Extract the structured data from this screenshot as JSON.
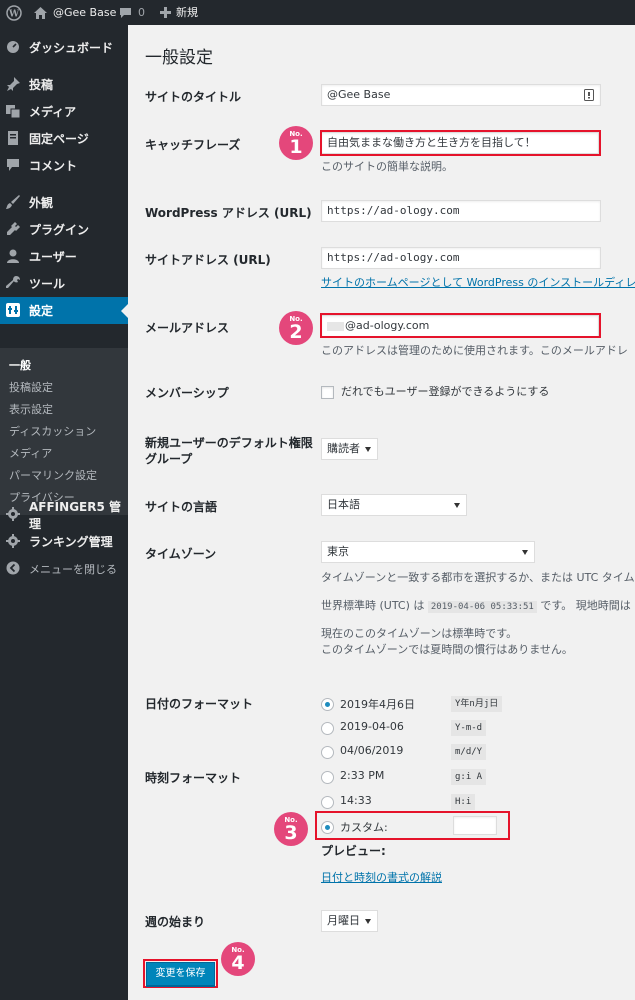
{
  "admin_bar": {
    "site_name": "@Gee Base",
    "comment_count": "0",
    "new_label": "新規"
  },
  "menu": {
    "dashboard": "ダッシュボード",
    "posts": "投稿",
    "media": "メディア",
    "pages": "固定ページ",
    "comments": "コメント",
    "appearance": "外観",
    "plugins": "プラグイン",
    "users": "ユーザー",
    "tools": "ツール",
    "settings": "設定",
    "submenu": [
      "一般",
      "投稿設定",
      "表示設定",
      "ディスカッション",
      "メディア",
      "パーマリンク設定",
      "プライバシー"
    ],
    "affinger": "AFFINGER5 管理",
    "ranking": "ランキング管理",
    "collapse": "メニューを閉じる"
  },
  "page_title": "一般設定",
  "fields": {
    "site_title": {
      "label": "サイトのタイトル",
      "value": "@Gee Base"
    },
    "tagline": {
      "label": "キャッチフレーズ",
      "value": "自由気ままな働き方と生き方を目指して！",
      "description": "このサイトの簡単な説明。"
    },
    "wp_address": {
      "label": "WordPress アドレス (URL)",
      "value": "https://ad-ology.com"
    },
    "site_address": {
      "label": "サイトアドレス (URL)",
      "value": "https://ad-ology.com",
      "description_link": "サイトのホームページとして WordPress のインストールディレ"
    },
    "email": {
      "label": "メールアドレス",
      "value": "@ad-ology.com",
      "description": "このアドレスは管理のために使用されます。このメールアドレ"
    },
    "membership": {
      "label": "メンバーシップ",
      "checkbox_label": "だれでもユーザー登録ができるようにする"
    },
    "default_role": {
      "label_line1": "新規ユーザーのデフォルト権限",
      "label_line2": "グループ",
      "value": "購読者"
    },
    "language": {
      "label": "サイトの言語",
      "value": "日本語"
    },
    "timezone": {
      "label": "タイムゾーン",
      "value": "東京",
      "description": "タイムゾーンと一致する都市を選択するか、または UTC タイム",
      "utc_prefix": "世界標準時 (UTC) は",
      "utc_value": "2019-04-06 05:33:51",
      "utc_suffix": "です。 現地時間は",
      "note1": "現在のこのタイムゾーンは標準時です。",
      "note2": "このタイムゾーンでは夏時間の慣行はありません。"
    },
    "date_format": {
      "label": "日付のフォーマット",
      "options": [
        {
          "label": "2019年4月6日",
          "code": "Y年n月j日",
          "checked": true
        },
        {
          "label": "2019-04-06",
          "code": "Y-m-d",
          "checked": false
        },
        {
          "label": "04/06/2019",
          "code": "m/d/Y",
          "checked": false
        }
      ]
    },
    "time_format": {
      "label": "時刻フォーマット",
      "options": [
        {
          "label": "2:33 PM",
          "code": "g:i A",
          "checked": false
        },
        {
          "label": "14:33",
          "code": "H:i",
          "checked": false
        }
      ],
      "custom_label": "カスタム:",
      "custom_value": "",
      "preview_label": "プレビュー:",
      "help_link": "日付と時刻の書式の解説"
    },
    "week_start": {
      "label": "週の始まり",
      "value": "月曜日"
    }
  },
  "save_button": "変更を保存",
  "badges": {
    "no_label": "No.",
    "numbers": [
      "1",
      "2",
      "3",
      "4"
    ]
  },
  "colors": {
    "admin_dark": "#23282d",
    "submenu_bg": "#32373c",
    "accent_blue": "#0073aa",
    "button_blue": "#0085ba",
    "highlight_red": "#e5132b",
    "badge_pink": "#e4477b"
  }
}
